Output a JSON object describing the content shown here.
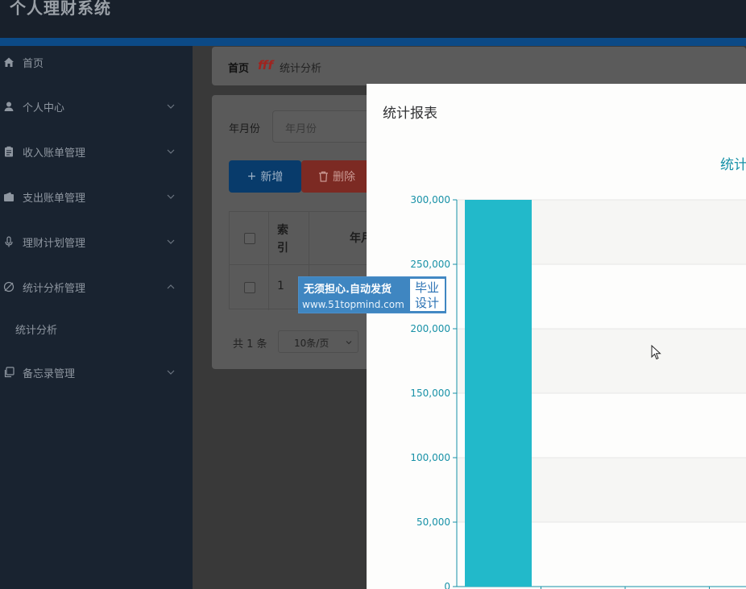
{
  "app": {
    "title": "个人理财系统"
  },
  "colors": {
    "sidebar_bg": "#192330",
    "accent": "#0c4a86",
    "chart_bar": "#22b9ca",
    "chart_axis": "#1791a7"
  },
  "sidebar": {
    "items": [
      {
        "label": "首页",
        "icon": "home-icon",
        "expandable": false
      },
      {
        "label": "个人中心",
        "icon": "user-icon",
        "expandable": true
      },
      {
        "label": "收入账单管理",
        "icon": "clipboard-icon",
        "expandable": true
      },
      {
        "label": "支出账单管理",
        "icon": "wallet-icon",
        "expandable": true
      },
      {
        "label": "理财计划管理",
        "icon": "microphone-icon",
        "expandable": true
      },
      {
        "label": "统计分析管理",
        "icon": "pie-slash-icon",
        "expandable": true,
        "expanded": true
      },
      {
        "label": "备忘录管理",
        "icon": "copy-icon",
        "expandable": true
      }
    ],
    "subitems": [
      {
        "label": "统计分析"
      }
    ]
  },
  "breadcrumb": {
    "home": "首页",
    "separator": "fff",
    "current": "统计分析"
  },
  "filter": {
    "label": "年月份",
    "placeholder": "年月份"
  },
  "toolbar": {
    "add_label": "新增",
    "delete_label": "删除"
  },
  "table": {
    "headers": [
      "索\n引",
      "年月"
    ],
    "rows": [
      {
        "index": "1"
      }
    ]
  },
  "pager": {
    "total": "共 1 条",
    "page_size": "10条/页"
  },
  "modal": {
    "title": "统计报表"
  },
  "chart_data": {
    "type": "bar",
    "title": "统计",
    "categories": [
      ""
    ],
    "values": [
      300000
    ],
    "ylim": [
      0,
      300000
    ],
    "yticks": [
      "0",
      "50,000",
      "100,000",
      "150,000",
      "200,000",
      "250,000",
      "300,000"
    ],
    "grid": true
  },
  "watermark": {
    "line1": "无须担心.自动发货",
    "line2": "www.51topmind.com",
    "badge": "毕业设计"
  }
}
